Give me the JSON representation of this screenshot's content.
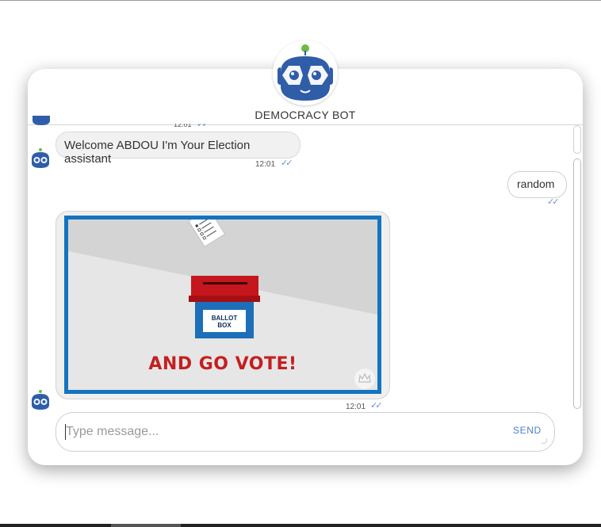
{
  "header": {
    "title": "DEMOCRACY BOT",
    "avatar_icon": "robot-face-icon"
  },
  "messages": [
    {
      "from": "bot",
      "text": "",
      "time": "12:01",
      "status_icon": "double-check-icon",
      "partial": true
    },
    {
      "from": "bot",
      "text": "Welcome ABDOU I'm Your Election assistant",
      "time": "12:01",
      "status_icon": "double-check-icon"
    },
    {
      "from": "user",
      "text": "random",
      "time": "",
      "status_icon": "double-check-icon"
    },
    {
      "from": "bot",
      "type": "image",
      "image": {
        "caption": "AND GO VOTE!",
        "box_label": "BALLOT BOX",
        "paper_label": "BALLOT",
        "border_color": "#1474bf",
        "caption_color": "#c41f1f",
        "box_lid_color": "#c4161c",
        "box_body_color": "#1c6fb8"
      },
      "time": "12:01",
      "status_icon": "double-check-icon"
    }
  ],
  "composer": {
    "placeholder": "Type message...",
    "value": "",
    "send_label": "SEND"
  },
  "colors": {
    "accent": "#4a82c8",
    "bot_blue": "#2f5da8",
    "tick": "#6a8fd0"
  }
}
